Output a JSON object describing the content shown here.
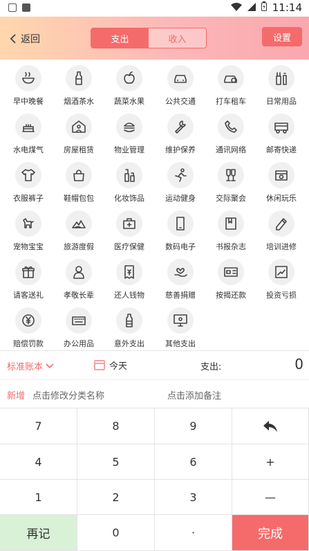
{
  "status": {
    "time": "11:14"
  },
  "header": {
    "back_label": "返回",
    "tabs": [
      {
        "label": "支出",
        "active": true
      },
      {
        "label": "收入",
        "active": false
      }
    ],
    "settings_label": "设置",
    "accent": "#f56b6b"
  },
  "categories": [
    {
      "label": "早中晚餐",
      "icon": "bowl-icon"
    },
    {
      "label": "烟酒茶水",
      "icon": "bottle-icon"
    },
    {
      "label": "蔬菜水果",
      "icon": "apple-icon"
    },
    {
      "label": "公共交通",
      "icon": "bus-front-icon"
    },
    {
      "label": "打车租车",
      "icon": "car-icon"
    },
    {
      "label": "日常用品",
      "icon": "toiletries-icon"
    },
    {
      "label": "水电煤气",
      "icon": "cake-icon"
    },
    {
      "label": "房屋租赁",
      "icon": "house-icon"
    },
    {
      "label": "物业管理",
      "icon": "burger-icon"
    },
    {
      "label": "维护保养",
      "icon": "wrench-icon"
    },
    {
      "label": "通讯网络",
      "icon": "phone-icon"
    },
    {
      "label": "邮寄快递",
      "icon": "truck-icon"
    },
    {
      "label": "衣服裤子",
      "icon": "shirt-icon"
    },
    {
      "label": "鞋帽包包",
      "icon": "bag-icon"
    },
    {
      "label": "化妆饰品",
      "icon": "cosmetics-icon"
    },
    {
      "label": "运动健身",
      "icon": "runner-icon"
    },
    {
      "label": "交际聚会",
      "icon": "glasses-icon"
    },
    {
      "label": "休闲玩乐",
      "icon": "radio-icon"
    },
    {
      "label": "宠物宝宝",
      "icon": "dog-icon"
    },
    {
      "label": "旅游度假",
      "icon": "mountain-icon"
    },
    {
      "label": "医疗保健",
      "icon": "medkit-icon"
    },
    {
      "label": "数码电子",
      "icon": "smartphone-icon"
    },
    {
      "label": "书报杂志",
      "icon": "book-icon"
    },
    {
      "label": "培训进修",
      "icon": "pencil-ruler-icon"
    },
    {
      "label": "请客送礼",
      "icon": "gift-icon"
    },
    {
      "label": "孝敬长辈",
      "icon": "elder-icon"
    },
    {
      "label": "还人钱物",
      "icon": "receipt-icon"
    },
    {
      "label": "慈善捐赠",
      "icon": "heart-hand-icon"
    },
    {
      "label": "按揭还款",
      "icon": "card-icon"
    },
    {
      "label": "投资亏损",
      "icon": "chart-icon"
    },
    {
      "label": "赔偿罚款",
      "icon": "yen-coin-icon"
    },
    {
      "label": "办公用品",
      "icon": "keyboard-icon"
    },
    {
      "label": "意外支出",
      "icon": "bottle2-icon"
    },
    {
      "label": "其他支出",
      "icon": "monitor-icon"
    }
  ],
  "entry": {
    "ledger_label": "标准账本",
    "date_label": "今天",
    "expense_label": "支出:",
    "amount": "0",
    "new_label": "新增",
    "edit_category_hint": "点击修改分类名称",
    "note_hint": "点击添加备注"
  },
  "keypad": {
    "keys": [
      "7",
      "8",
      "9",
      "undo-icon",
      "4",
      "5",
      "6",
      "+",
      "1",
      "2",
      "3",
      "—",
      "再记",
      "0",
      "·",
      "完成"
    ],
    "again_color": "#d8f1d7",
    "done_color": "#f56b6b"
  }
}
